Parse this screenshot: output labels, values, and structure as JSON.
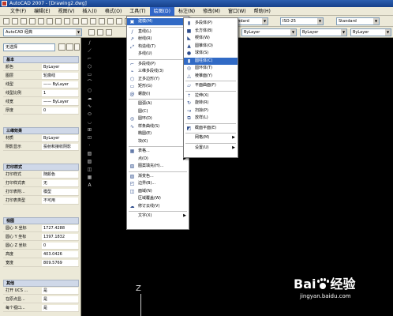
{
  "window": {
    "title": "AutoCAD 2007 - [Drawing2.dwg]"
  },
  "menubar": {
    "items": [
      "文件(F)",
      "编辑(E)",
      "视图(V)",
      "插入(I)",
      "格式(O)",
      "工具(T)",
      "绘图(D)",
      "标注(N)",
      "修改(M)",
      "窗口(W)",
      "帮助(H)"
    ],
    "active": "绘图(D)"
  },
  "toolbar": {
    "workspace": "AutoCAD 经典",
    "textstyle": "Standard",
    "dimstyle": "ISO-25",
    "tablestyle": "Standard",
    "layer": "ByLayer",
    "linetype": "ByLayer",
    "lineweight": "ByLayer"
  },
  "palette": {
    "selection": "无选择",
    "sections": [
      {
        "title": "基本",
        "rows": [
          {
            "k": "颜色",
            "v": "ByLayer"
          },
          {
            "k": "图层",
            "v": "轮廓线"
          },
          {
            "k": "线型",
            "v": "—— ByLayer"
          },
          {
            "k": "线型比例",
            "v": "1"
          },
          {
            "k": "线宽",
            "v": "—— ByLayer"
          },
          {
            "k": "厚度",
            "v": "0"
          }
        ]
      },
      {
        "title": "三维效果",
        "rows": [
          {
            "k": "材质",
            "v": "ByLayer"
          },
          {
            "k": "阴影显示",
            "v": "投射和接收阴影"
          }
        ]
      },
      {
        "title": "打印样式",
        "rows": [
          {
            "k": "打印样式",
            "v": "随颜色"
          },
          {
            "k": "打印样式表",
            "v": "无"
          },
          {
            "k": "打印表附...",
            "v": "模型"
          },
          {
            "k": "打印表类型",
            "v": "不可用"
          }
        ]
      },
      {
        "title": "视图",
        "rows": [
          {
            "k": "圆心 X 坐标",
            "v": "1727.4288"
          },
          {
            "k": "圆心 Y 坐标",
            "v": "1397.1832"
          },
          {
            "k": "圆心 Z 坐标",
            "v": "0"
          },
          {
            "k": "高度",
            "v": "403.0426"
          },
          {
            "k": "宽度",
            "v": "809.5769"
          }
        ]
      },
      {
        "title": "其他",
        "rows": [
          {
            "k": "打开 UCS ...",
            "v": "是"
          },
          {
            "k": "在原点显...",
            "v": "是"
          },
          {
            "k": "每个视口...",
            "v": "是"
          }
        ]
      }
    ]
  },
  "draw_menu": {
    "items": [
      {
        "label": "建模(M)",
        "icon": "cube-icon",
        "submenu": true,
        "highlight": true
      },
      {
        "sep": true
      },
      {
        "label": "直线(L)",
        "icon": "line-icon"
      },
      {
        "label": "射线(R)",
        "icon": "ray-icon"
      },
      {
        "label": "构造线(T)",
        "icon": "xline-icon"
      },
      {
        "label": "多线(U)",
        "icon": ""
      },
      {
        "sep": true
      },
      {
        "label": "多段线(P)",
        "icon": "polyline-icon"
      },
      {
        "label": "三维多段线(3)",
        "icon": "polyline3d-icon"
      },
      {
        "label": "正多边形(Y)",
        "icon": "polygon-icon"
      },
      {
        "label": "矩形(G)",
        "icon": "rectangle-icon"
      },
      {
        "label": "螺旋(I)",
        "icon": "helix-icon"
      },
      {
        "sep": true
      },
      {
        "label": "圆弧(A)",
        "icon": "",
        "submenu": true
      },
      {
        "label": "圆(C)",
        "icon": "",
        "submenu": true
      },
      {
        "label": "圆环(D)",
        "icon": "donut-icon"
      },
      {
        "label": "样条曲线(S)",
        "icon": "spline-icon"
      },
      {
        "label": "椭圆(E)",
        "icon": "",
        "submenu": true
      },
      {
        "label": "块(K)",
        "icon": "",
        "submenu": true
      },
      {
        "sep": true
      },
      {
        "label": "表格...",
        "icon": "table-icon"
      },
      {
        "label": "点(O)",
        "icon": "",
        "submenu": true
      },
      {
        "label": "图案填充(H)...",
        "icon": "hatch-icon"
      },
      {
        "sep": true
      },
      {
        "label": "渐变色...",
        "icon": "gradient-icon"
      },
      {
        "label": "边界(B)...",
        "icon": "boundary-icon"
      },
      {
        "label": "面域(N)",
        "icon": "region-icon"
      },
      {
        "label": "区域覆盖(W)",
        "icon": ""
      },
      {
        "label": "修订云线(V)",
        "icon": "revcloud-icon"
      },
      {
        "sep": true
      },
      {
        "label": "文字(X)",
        "icon": "",
        "submenu": true
      }
    ]
  },
  "modeling_menu": {
    "items": [
      {
        "label": "多段体(P)",
        "icon": "polysolid-icon"
      },
      {
        "label": "长方体(B)",
        "icon": "box-icon"
      },
      {
        "label": "楔体(W)",
        "icon": "wedge-icon"
      },
      {
        "label": "圆锥体(O)",
        "icon": "cone-icon"
      },
      {
        "label": "球体(S)",
        "icon": "sphere-icon"
      },
      {
        "label": "圆柱体(C)",
        "icon": "cylinder-icon",
        "highlight": true
      },
      {
        "label": "圆环体(T)",
        "icon": "torus-icon"
      },
      {
        "label": "棱锥面(Y)",
        "icon": "pyramid-icon"
      },
      {
        "sep": true
      },
      {
        "label": "平面曲面(F)",
        "icon": "planesurf-icon"
      },
      {
        "sep": true
      },
      {
        "label": "拉伸(X)",
        "icon": "extrude-icon"
      },
      {
        "label": "旋转(R)",
        "icon": "revolve-icon"
      },
      {
        "label": "扫掠(P)",
        "icon": "sweep-icon"
      },
      {
        "label": "放样(L)",
        "icon": "loft-icon"
      },
      {
        "sep": true
      },
      {
        "label": "截面平面(E)",
        "icon": "section-icon"
      },
      {
        "sep": true
      },
      {
        "label": "网格(M)",
        "icon": "",
        "submenu": true
      },
      {
        "sep": true
      },
      {
        "label": "设置(U)",
        "icon": "",
        "submenu": true
      }
    ]
  },
  "canvas": {
    "ucs_label": "Z"
  },
  "watermark": {
    "brand": "Bai",
    "brand2": "经验",
    "url": "jingyan.baidu.com"
  }
}
